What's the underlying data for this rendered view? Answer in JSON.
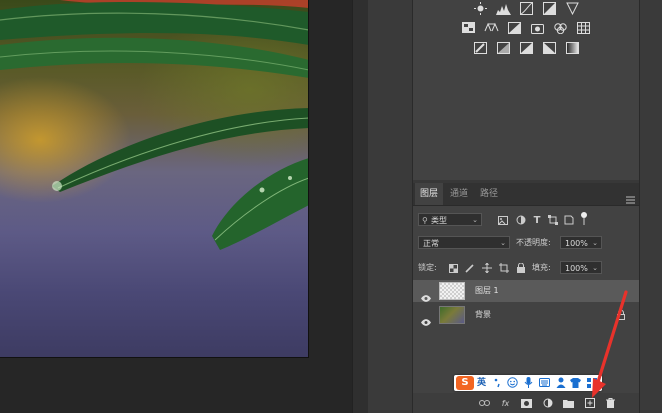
{
  "layers_panel": {
    "tabs": [
      {
        "label": "图层",
        "active": true
      },
      {
        "label": "通道",
        "active": false
      },
      {
        "label": "路径",
        "active": false
      }
    ],
    "filter": {
      "value": "类型"
    },
    "blend_mode": {
      "value": "正常"
    },
    "opacity": {
      "label": "不透明度:",
      "value": "100%"
    },
    "lock": {
      "label": "锁定:"
    },
    "fill": {
      "label": "填充:",
      "value": "100%"
    },
    "layers": [
      {
        "name": "图层 1",
        "selected": true,
        "visible": true,
        "locked": false
      },
      {
        "name": "背景",
        "selected": false,
        "visible": true,
        "locked": true
      }
    ],
    "bottom_icons": [
      "link-icon",
      "fx-icon",
      "mask-icon",
      "adjustment-icon",
      "folder-icon",
      "new-layer-icon",
      "trash-icon"
    ],
    "fx_label": "fx"
  },
  "adjustments_panel": {
    "rows": [
      [
        "brightness-icon",
        "levels-icon",
        "curves-icon",
        "exposure-icon",
        "vibrance-icon"
      ],
      [
        "hue-saturation-icon",
        "color-balance-icon",
        "black-white-icon",
        "photo-filter-icon",
        "channel-mixer-icon",
        "color-lookup-icon"
      ],
      [
        "invert-icon",
        "posterize-icon",
        "threshold-icon",
        "selective-color-icon",
        "gradient-map-icon"
      ]
    ]
  },
  "ime_toolbar": {
    "logo": "S",
    "language": "英",
    "icons": [
      "punctuation-icon",
      "emoji-icon",
      "microphone-icon",
      "keyboard-icon",
      "user-icon",
      "shirt-icon",
      "grid-icon"
    ]
  },
  "colors": {
    "panel_bg": "#424242",
    "selected_layer": "#5a5a5a",
    "annotation_arrow": "#e8322b",
    "ime_logo": "#f26522"
  }
}
